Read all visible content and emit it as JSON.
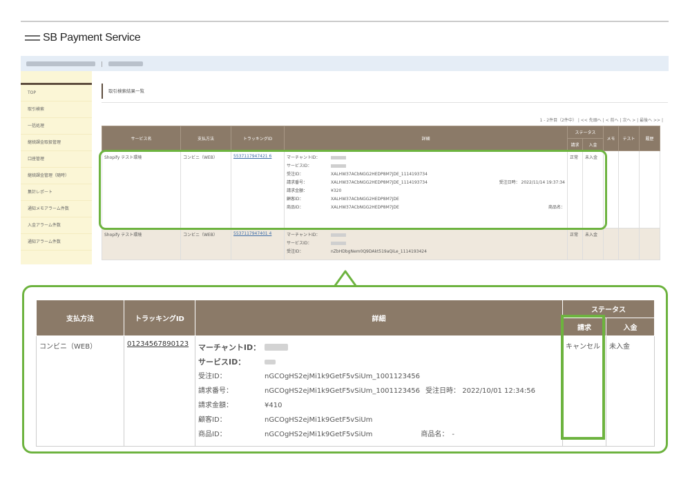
{
  "app": {
    "logo_text": "SB Payment Service"
  },
  "sidebar": {
    "items": [
      {
        "label": "TOP"
      },
      {
        "label": "取引検索"
      },
      {
        "label": "一括処理"
      },
      {
        "label": "継続課金取扱管理"
      },
      {
        "label": "口座管理"
      },
      {
        "label": "継続課金管理（随時）"
      },
      {
        "label": "集計レポート"
      },
      {
        "label": "通知メモアラーム件数"
      },
      {
        "label": "入金アラーム件数"
      },
      {
        "label": "通知アラーム件数"
      }
    ]
  },
  "inner": {
    "page_title": "取引検索結果一覧",
    "pager": "1 - 2件目（2件中） |  <<  先頭へ  |  < 前へ  |  次へ >  |  最後へ  >> |",
    "columns": {
      "service": "サービス名",
      "method": "支払方法",
      "tracking": "トラッキングID",
      "detail": "詳細",
      "status": "ステータス",
      "billing": "請求",
      "deposit": "入金",
      "memo": "メモ",
      "test": "テスト",
      "history": "履歴"
    },
    "rows": [
      {
        "service": "Shopify テスト環境",
        "method": "コンビニ（WEB）",
        "tracking": "5537117947421 6",
        "details": [
          {
            "k": "マーチャントID：",
            "v": ""
          },
          {
            "k": "サービスID：",
            "v": ""
          },
          {
            "k": "受注ID：",
            "v": "XALHW37ACbNGG2HEDP8M7JDE_1114193734"
          },
          {
            "k": "請求番号：",
            "v": "XALHW37ACbNGG2HEDP8M7JDE_1114193734",
            "extra": "受注日時： 2022/11/14 19:37:34"
          },
          {
            "k": "請求金額：",
            "v": "¥320"
          },
          {
            "k": "顧客ID：",
            "v": "XALHW37ACbNGG2HEDP8M7JDE"
          },
          {
            "k": "商品ID：",
            "v": "XALHW37ACbNGG2HEDP8M7JDE",
            "extra": "商品名："
          }
        ],
        "billing": "正常",
        "deposit": "未入金"
      },
      {
        "service": "Shopify テスト環境",
        "method": "コンビニ（WEB）",
        "tracking": "5537117947401 4",
        "details": [
          {
            "k": "マーチャントID：",
            "v": ""
          },
          {
            "k": "サービスID：",
            "v": ""
          },
          {
            "k": "受注ID：",
            "v": "nZbHDbgNem0Q9DAkt519aQiLe_1114193424"
          }
        ],
        "billing": "正常",
        "deposit": "未入金"
      }
    ]
  },
  "zoom": {
    "columns": {
      "method": "支払方法",
      "tracking": "トラッキングID",
      "detail": "詳細",
      "status": "ステータス",
      "billing": "請求",
      "deposit": "入金"
    },
    "row": {
      "method": "コンビニ（WEB）",
      "tracking": "01234567890123",
      "billing": "キャンセル",
      "deposit": "未入金",
      "details": [
        {
          "k": "マーチャントID：",
          "v": ""
        },
        {
          "k": "サービスID：",
          "v": ""
        },
        {
          "k": "受注ID：",
          "v": "nGCOgHS2ejMi1k9GetF5vSiUm_1001123456"
        },
        {
          "k": "請求番号：",
          "v": "nGCOgHS2ejMi1k9GetF5vSiUm_1001123456",
          "extra": "受注日時： 2022/10/01 12:34:56"
        },
        {
          "k": "請求金額：",
          "v": "¥410"
        },
        {
          "k": "顧客ID：",
          "v": "nGCOgHS2ejMi1k9GetF5vSiUm"
        },
        {
          "k": "商品ID：",
          "v": "nGCOgHS2ejMi1k9GetF5vSiUm",
          "extra": "商品名：　-"
        }
      ]
    }
  },
  "colors": {
    "header_brown": "#8b7a68",
    "highlight_green": "#6db33f",
    "sidebar_yellow": "#fbf6d6",
    "strip_blue": "#e5edf6"
  }
}
